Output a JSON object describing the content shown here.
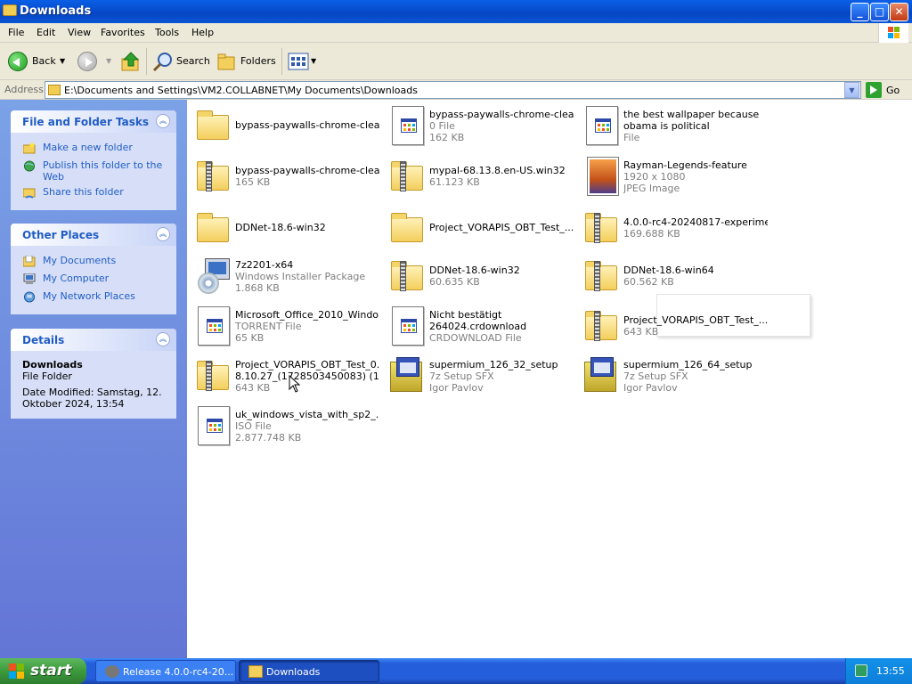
{
  "window": {
    "title": "Downloads",
    "buttons": {
      "minimize": "_",
      "maximize": "□",
      "close": "✕"
    }
  },
  "menu": [
    "File",
    "Edit",
    "View",
    "Favorites",
    "Tools",
    "Help"
  ],
  "toolbar": {
    "back": "Back",
    "search": "Search",
    "folders": "Folders"
  },
  "address": {
    "label": "Address",
    "path": "E:\\Documents and Settings\\VM2.COLLABNET\\My Documents\\Downloads",
    "go": "Go"
  },
  "tasks_panel": {
    "title": "File and Folder Tasks",
    "links": [
      "Make a new folder",
      "Publish this folder to the Web",
      "Share this folder"
    ]
  },
  "places_panel": {
    "title": "Other Places",
    "links": [
      "My Documents",
      "My Computer",
      "My Network Places"
    ]
  },
  "details_panel": {
    "title": "Details",
    "name": "Downloads",
    "type": "File Folder",
    "modified": "Date Modified: Samstag, 12. Oktober 2024, 13:54"
  },
  "files": [
    {
      "name": "bypass-paywalls-chrome-clea...",
      "l2": "",
      "l3": "",
      "icon": "folder-icon"
    },
    {
      "name": "bypass-paywalls-chrome-clea...",
      "l2": "0 File",
      "l3": "162 KB",
      "icon": "generic-file-icon"
    },
    {
      "name": "the best wallpaper because",
      "l2": "obama is political",
      "l3": "File",
      "icon": "generic-file-icon",
      "name_black_l2": true
    },
    {
      "name": "bypass-paywalls-chrome-clea...",
      "l2": "165 KB",
      "l3": "",
      "icon": "zip-folder-icon"
    },
    {
      "name": "mypal-68.13.8.en-US.win32",
      "l2": "61.123 KB",
      "l3": "",
      "icon": "zip-folder-icon"
    },
    {
      "name": "Rayman-Legends-feature",
      "l2": "1920 x 1080",
      "l3": "JPEG Image",
      "icon": "jpeg-image-icon"
    },
    {
      "name": "DDNet-18.6-win32",
      "l2": "",
      "l3": "",
      "icon": "folder-icon"
    },
    {
      "name": "Project_VORAPIS_OBT_Test_...",
      "l2": "",
      "l3": "",
      "icon": "folder-icon"
    },
    {
      "name": "4.0.0-rc4-20240817-experime...",
      "l2": "169.688 KB",
      "l3": "",
      "icon": "zip-folder-icon"
    },
    {
      "name": "7z2201-x64",
      "l2": "Windows Installer Package",
      "l3": "1.868 KB",
      "icon": "installer-package-icon"
    },
    {
      "name": "DDNet-18.6-win32",
      "l2": "60.635 KB",
      "l3": "",
      "icon": "zip-folder-icon"
    },
    {
      "name": "DDNet-18.6-win64",
      "l2": "60.562 KB",
      "l3": "",
      "icon": "zip-folder-icon"
    },
    {
      "name": "Microsoft_Office_2010_Windo...",
      "l2": "TORRENT File",
      "l3": "65 KB",
      "icon": "generic-file-icon"
    },
    {
      "name": "Nicht bestätigt",
      "l2": "264024.crdownload",
      "l3": "CRDOWNLOAD File",
      "icon": "generic-file-icon",
      "name_black_l2": true
    },
    {
      "name": "Project_VORAPIS_OBT_Test_...",
      "l2": "643 KB",
      "l3": "",
      "icon": "zip-folder-icon"
    },
    {
      "name": "Project_VORAPIS_OBT_Test_0.",
      "l2": "8.10.27_(1728503450083) (1)",
      "l3": "643 KB",
      "icon": "zip-folder-icon",
      "name_black_l2": true
    },
    {
      "name": "supermium_126_32_setup",
      "l2": "7z Setup SFX",
      "l3": "Igor Pavlov",
      "icon": "setup-sfx-icon"
    },
    {
      "name": "supermium_126_64_setup",
      "l2": "7z Setup SFX",
      "l3": "Igor Pavlov",
      "icon": "setup-sfx-icon"
    },
    {
      "name": "uk_windows_vista_with_sp2_...",
      "l2": "ISO File",
      "l3": "2.877.748 KB",
      "icon": "generic-file-icon"
    }
  ],
  "taskbar": {
    "start": "start",
    "tasks": [
      "Release 4.0.0-rc4-20...",
      "Downloads"
    ],
    "clock": "13:55"
  }
}
